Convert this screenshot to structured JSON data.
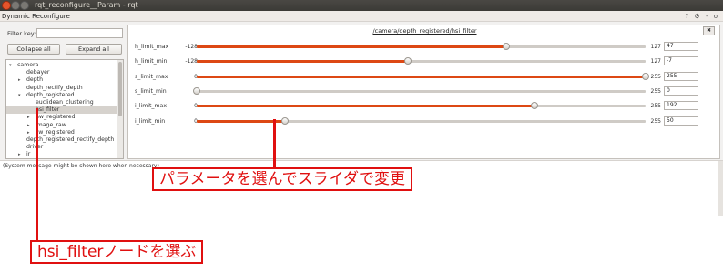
{
  "window": {
    "title": "rqt_reconfigure__Param - rqt"
  },
  "plugin": {
    "title": "Dynamic Reconfigure",
    "icons": [
      "help-icon",
      "settings-icon",
      "minimize-icon",
      "close-icon"
    ]
  },
  "filter": {
    "label": "Filter key:",
    "value": ""
  },
  "buttons": {
    "collapse": "Collapse all",
    "expand": "Expand all"
  },
  "tree": {
    "items": [
      {
        "label": "camera",
        "arrow": "▾",
        "indent": 0,
        "selected": false
      },
      {
        "label": "debayer",
        "arrow": "",
        "indent": 1,
        "selected": false
      },
      {
        "label": "depth",
        "arrow": "▸",
        "indent": 1,
        "selected": false
      },
      {
        "label": "depth_rectify_depth",
        "arrow": "",
        "indent": 1,
        "selected": false
      },
      {
        "label": "depth_registered",
        "arrow": "▾",
        "indent": 1,
        "selected": false
      },
      {
        "label": "euclidean_clustering",
        "arrow": "",
        "indent": 2,
        "selected": false
      },
      {
        "label": "hsi_filter",
        "arrow": "",
        "indent": 2,
        "selected": true
      },
      {
        "label": "hw_registered",
        "arrow": "▸",
        "indent": 2,
        "selected": false
      },
      {
        "label": "image_raw",
        "arrow": "▸",
        "indent": 2,
        "selected": false
      },
      {
        "label": "sw_registered",
        "arrow": "▸",
        "indent": 2,
        "selected": false
      },
      {
        "label": "depth_registered_rectify_depth",
        "arrow": "",
        "indent": 1,
        "selected": false
      },
      {
        "label": "driver",
        "arrow": "",
        "indent": 1,
        "selected": false
      },
      {
        "label": "ir",
        "arrow": "▸",
        "indent": 1,
        "selected": false
      }
    ]
  },
  "node_panel": {
    "title": "/camera/depth_registered/hsi_filter",
    "close_label": "✖",
    "params": [
      {
        "name": "h_limit_max",
        "min": "-128",
        "max": "127",
        "value": "47",
        "fraction": 0.69
      },
      {
        "name": "h_limit_min",
        "min": "-128",
        "max": "127",
        "value": "-7",
        "fraction": 0.47
      },
      {
        "name": "s_limit_max",
        "min": "0",
        "max": "255",
        "value": "255",
        "fraction": 1.0
      },
      {
        "name": "s_limit_min",
        "min": "0",
        "max": "255",
        "value": "0",
        "fraction": 0.0
      },
      {
        "name": "i_limit_max",
        "min": "0",
        "max": "255",
        "value": "192",
        "fraction": 0.753
      },
      {
        "name": "i_limit_min",
        "min": "0",
        "max": "255",
        "value": "50",
        "fraction": 0.196
      }
    ]
  },
  "status": {
    "text": "(System message might be shown here when necessary)"
  },
  "annotations": {
    "slider_note": "パラメータを選んでスライダで変更",
    "node_note": "hsi_filterノードを選ぶ"
  },
  "colors": {
    "accent": "#dd4814",
    "annotation": "#e01010"
  }
}
